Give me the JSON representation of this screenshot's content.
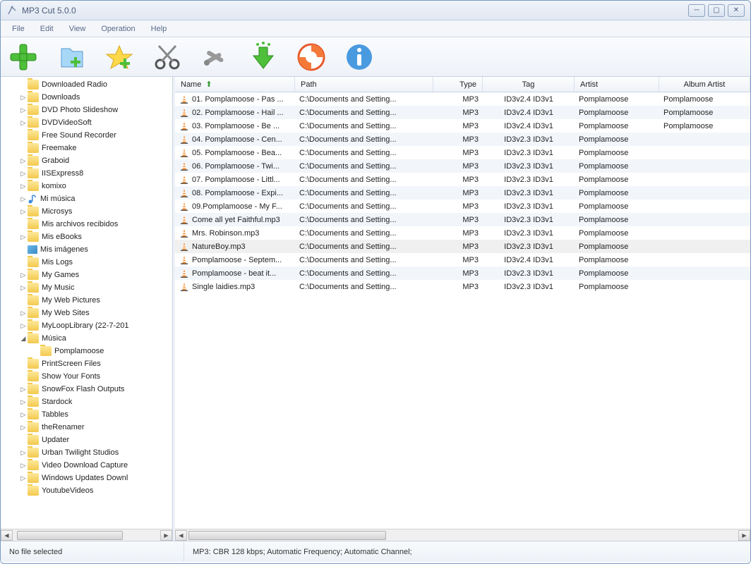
{
  "window": {
    "title": "MP3 Cut 5.0.0"
  },
  "menu": [
    "File",
    "Edit",
    "View",
    "Operation",
    "Help"
  ],
  "tree": [
    {
      "label": "Downloaded Radio",
      "expand": "",
      "icon": "folder",
      "indent": 1
    },
    {
      "label": "Downloads",
      "expand": "▷",
      "icon": "folder",
      "indent": 1
    },
    {
      "label": "DVD Photo Slideshow",
      "expand": "▷",
      "icon": "folder",
      "indent": 1
    },
    {
      "label": "DVDVideoSoft",
      "expand": "▷",
      "icon": "folder",
      "indent": 1
    },
    {
      "label": "Free Sound Recorder",
      "expand": "",
      "icon": "folder",
      "indent": 1
    },
    {
      "label": "Freemake",
      "expand": "",
      "icon": "folder",
      "indent": 1
    },
    {
      "label": "Graboid",
      "expand": "▷",
      "icon": "folder",
      "indent": 1
    },
    {
      "label": "IISExpress8",
      "expand": "▷",
      "icon": "folder",
      "indent": 1
    },
    {
      "label": "komixo",
      "expand": "▷",
      "icon": "folder",
      "indent": 1
    },
    {
      "label": "Mi música",
      "expand": "▷",
      "icon": "music",
      "indent": 1
    },
    {
      "label": "Microsys",
      "expand": "▷",
      "icon": "folder",
      "indent": 1
    },
    {
      "label": "Mis archivos recibidos",
      "expand": "",
      "icon": "folder",
      "indent": 1
    },
    {
      "label": "Mis eBooks",
      "expand": "▷",
      "icon": "folder",
      "indent": 1
    },
    {
      "label": "Mis imágenes",
      "expand": "",
      "icon": "image",
      "indent": 1
    },
    {
      "label": "Mis Logs",
      "expand": "",
      "icon": "folder",
      "indent": 1
    },
    {
      "label": "My Games",
      "expand": "▷",
      "icon": "folder",
      "indent": 1
    },
    {
      "label": "My Music",
      "expand": "▷",
      "icon": "folder",
      "indent": 1
    },
    {
      "label": "My Web Pictures",
      "expand": "",
      "icon": "folder",
      "indent": 1
    },
    {
      "label": "My Web Sites",
      "expand": "▷",
      "icon": "folder",
      "indent": 1
    },
    {
      "label": "MyLoopLibrary (22-7-201",
      "expand": "▷",
      "icon": "folder",
      "indent": 1
    },
    {
      "label": "Música",
      "expand": "◢",
      "icon": "folder",
      "indent": 1
    },
    {
      "label": "Pomplamoose",
      "expand": "",
      "icon": "folder",
      "indent": 2
    },
    {
      "label": "PrintScreen Files",
      "expand": "",
      "icon": "folder",
      "indent": 1
    },
    {
      "label": "Show Your Fonts",
      "expand": "",
      "icon": "folder",
      "indent": 1
    },
    {
      "label": "SnowFox Flash Outputs",
      "expand": "▷",
      "icon": "folder",
      "indent": 1
    },
    {
      "label": "Stardock",
      "expand": "▷",
      "icon": "folder",
      "indent": 1
    },
    {
      "label": "Tabbles",
      "expand": "▷",
      "icon": "folder",
      "indent": 1
    },
    {
      "label": "theRenamer",
      "expand": "▷",
      "icon": "folder",
      "indent": 1
    },
    {
      "label": "Updater",
      "expand": "",
      "icon": "folder",
      "indent": 1
    },
    {
      "label": "Urban Twilight Studios",
      "expand": "▷",
      "icon": "folder",
      "indent": 1
    },
    {
      "label": "Video Download Capture",
      "expand": "▷",
      "icon": "folder",
      "indent": 1
    },
    {
      "label": "Windows Updates Downl",
      "expand": "▷",
      "icon": "folder",
      "indent": 1
    },
    {
      "label": "YoutubeVideos",
      "expand": "",
      "icon": "folder",
      "indent": 1
    }
  ],
  "columns": {
    "name": "Name",
    "path": "Path",
    "type": "Type",
    "tag": "Tag",
    "artist": "Artist",
    "aartist": "Album Artist"
  },
  "files": [
    {
      "name": "01. Pomplamoose - Pas ...",
      "path": "C:\\Documents and Setting...",
      "type": "MP3",
      "tag": "ID3v2.4 ID3v1",
      "artist": "Pomplamoose",
      "aartist": "Pomplamoose",
      "selected": false
    },
    {
      "name": "02. Pomplamoose - Hail ...",
      "path": "C:\\Documents and Setting...",
      "type": "MP3",
      "tag": "ID3v2.4 ID3v1",
      "artist": "Pomplamoose",
      "aartist": "Pomplamoose",
      "selected": false
    },
    {
      "name": "03. Pomplamoose - Be ...",
      "path": "C:\\Documents and Setting...",
      "type": "MP3",
      "tag": "ID3v2.4 ID3v1",
      "artist": "Pomplamoose",
      "aartist": "Pomplamoose",
      "selected": false
    },
    {
      "name": "04. Pomplamoose - Cen...",
      "path": "C:\\Documents and Setting...",
      "type": "MP3",
      "tag": "ID3v2.3 ID3v1",
      "artist": "Pomplamoose",
      "aartist": "",
      "selected": false
    },
    {
      "name": "05. Pomplamoose - Bea...",
      "path": "C:\\Documents and Setting...",
      "type": "MP3",
      "tag": "ID3v2.3 ID3v1",
      "artist": "Pomplamoose",
      "aartist": "",
      "selected": false
    },
    {
      "name": "06. Pomplamoose - Twi...",
      "path": "C:\\Documents and Setting...",
      "type": "MP3",
      "tag": "ID3v2.3 ID3v1",
      "artist": "Pomplamoose",
      "aartist": "",
      "selected": false
    },
    {
      "name": "07. Pomplamoose - Littl...",
      "path": "C:\\Documents and Setting...",
      "type": "MP3",
      "tag": "ID3v2.3 ID3v1",
      "artist": "Pomplamoose",
      "aartist": "",
      "selected": false
    },
    {
      "name": "08. Pomplamoose - Expi...",
      "path": "C:\\Documents and Setting...",
      "type": "MP3",
      "tag": "ID3v2.3 ID3v1",
      "artist": "Pomplamoose",
      "aartist": "",
      "selected": false
    },
    {
      "name": "09.Pomplamoose - My F...",
      "path": "C:\\Documents and Setting...",
      "type": "MP3",
      "tag": "ID3v2.3 ID3v1",
      "artist": "Pomplamoose",
      "aartist": "",
      "selected": false
    },
    {
      "name": "Come all yet Faithful.mp3",
      "path": "C:\\Documents and Setting...",
      "type": "MP3",
      "tag": "ID3v2.3 ID3v1",
      "artist": "Pomplamoose",
      "aartist": "",
      "selected": false
    },
    {
      "name": "Mrs. Robinson.mp3",
      "path": "C:\\Documents and Setting...",
      "type": "MP3",
      "tag": "ID3v2.3 ID3v1",
      "artist": "Pomplamoose",
      "aartist": "",
      "selected": false
    },
    {
      "name": "NatureBoy.mp3",
      "path": "C:\\Documents and Setting...",
      "type": "MP3",
      "tag": "ID3v2.3 ID3v1",
      "artist": "Pomplamoose",
      "aartist": "",
      "selected": true
    },
    {
      "name": "Pomplamoose - Septem...",
      "path": "C:\\Documents and Setting...",
      "type": "MP3",
      "tag": "ID3v2.4 ID3v1",
      "artist": "Pomplamoose",
      "aartist": "",
      "selected": false
    },
    {
      "name": "Pomplamoose - beat it...",
      "path": "C:\\Documents and Setting...",
      "type": "MP3",
      "tag": "ID3v2.3 ID3v1",
      "artist": "Pomplamoose",
      "aartist": "",
      "selected": false
    },
    {
      "name": "Single laidies.mp3",
      "path": "C:\\Documents and Setting...",
      "type": "MP3",
      "tag": "ID3v2.3 ID3v1",
      "artist": "Pomplamoose",
      "aartist": "",
      "selected": false
    }
  ],
  "status": {
    "left": "No file selected",
    "right": "MP3:  CBR 128 kbps; Automatic Frequency; Automatic Channel;"
  }
}
